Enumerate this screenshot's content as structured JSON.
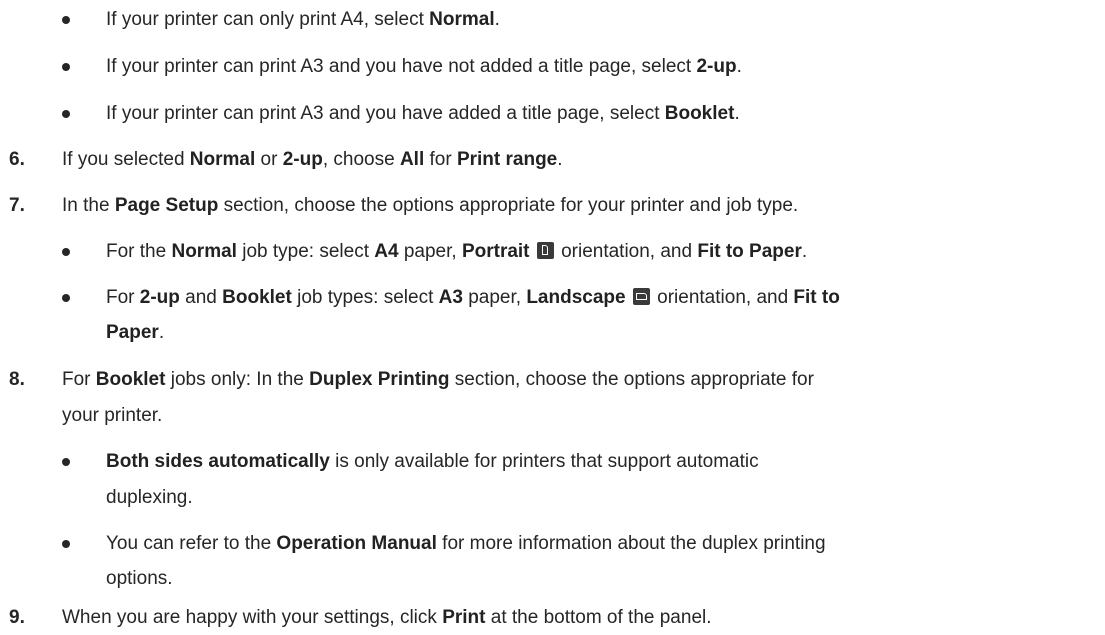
{
  "bullets_top": {
    "b1": {
      "pre": "If your printer can only print A4, select ",
      "bold": "Normal",
      "post": "."
    },
    "b2": {
      "pre": "If your printer can print A3 and you have not added a title page, select ",
      "bold": "2-up",
      "post": "."
    },
    "b3": {
      "pre": "If your printer can print A3 and you have added a title page, select ",
      "bold": "Booklet",
      "post": "."
    }
  },
  "step6": {
    "num": "6.",
    "t1": "If you selected ",
    "b1": "Normal",
    "t2": " or ",
    "b2": "2-up",
    "t3": ", choose ",
    "b3": "All",
    "t4": " for ",
    "b4": "Print range",
    "t5": "."
  },
  "step7": {
    "num": "7.",
    "t1": "In the ",
    "b1": "Page Setup",
    "t2": " section, choose the options appropriate for your printer and job type.",
    "bullet1": {
      "t1": "For the ",
      "b1": "Normal",
      "t2": " job type: select ",
      "b2": "A4",
      "t3": " paper, ",
      "b3": "Portrait",
      "t4": " orientation, and ",
      "b4": "Fit to Paper",
      "t5": "."
    },
    "bullet2": {
      "t1": "For ",
      "b1": "2-up",
      "t2": " and ",
      "b2": "Booklet",
      "t3": " job types: select ",
      "b3": "A3",
      "t4": " paper, ",
      "b4": "Landscape",
      "t5": " orientation, and ",
      "b5": "Fit to",
      "line2_bold": "Paper",
      "line2_post": "."
    }
  },
  "step8": {
    "num": "8.",
    "t1": "For ",
    "b1": "Booklet",
    "t2": " jobs only: In the ",
    "b2": "Duplex Printing",
    "t3": " section, choose the options appropriate for",
    "line2": "your printer.",
    "bullet1": {
      "b1": "Both sides automatically",
      "t1": " is only available for printers that support automatic",
      "line2": "duplexing."
    },
    "bullet2": {
      "t1": "You can refer to the ",
      "b1": "Operation Manual",
      "t2": " for more information about the duplex printing",
      "line2": "options."
    }
  },
  "step9": {
    "num": "9.",
    "t1": "When you are happy with your settings, click ",
    "b1": "Print",
    "t2": " at the bottom of the panel."
  },
  "icons": {
    "portrait": "portrait-orientation-icon",
    "landscape": "landscape-orientation-icon"
  }
}
